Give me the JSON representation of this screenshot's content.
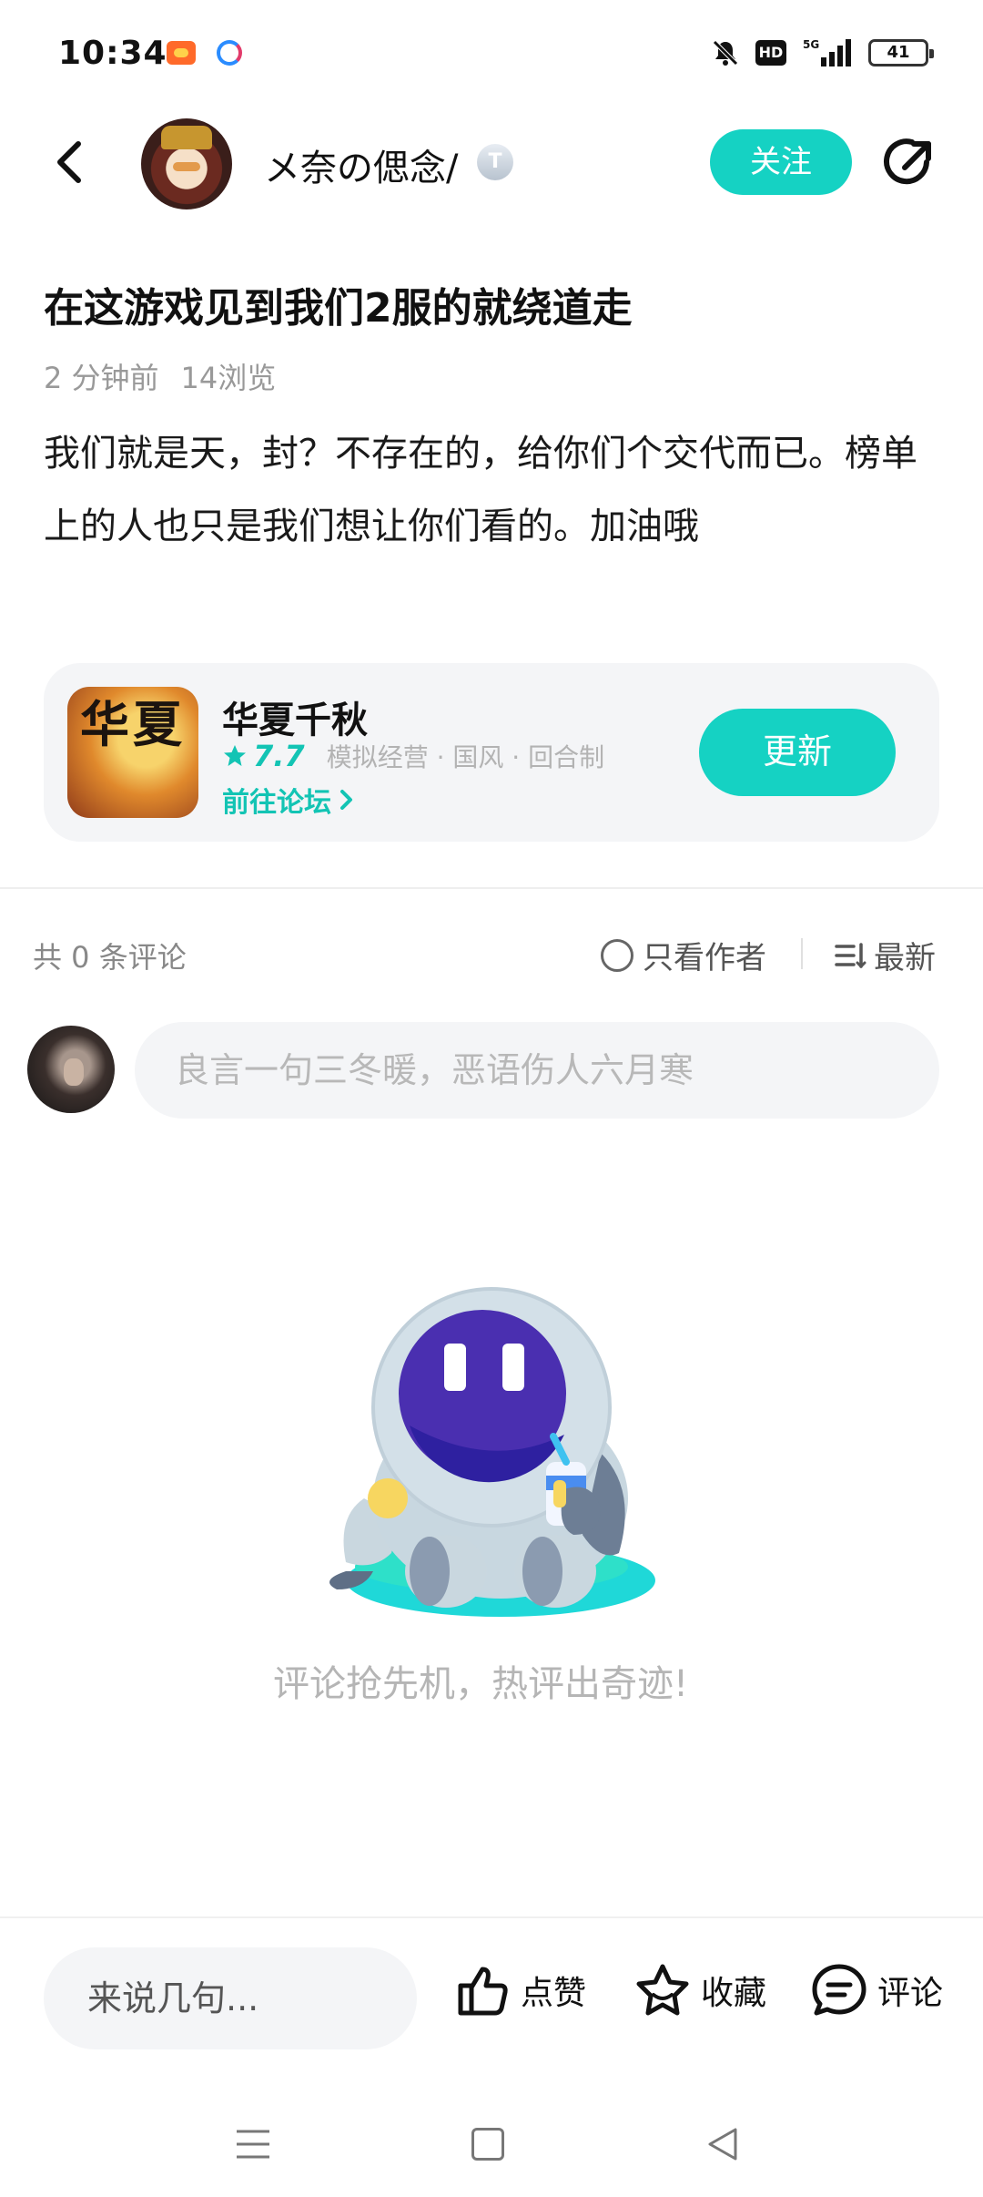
{
  "status_bar": {
    "time": "10:34",
    "hd": "HD",
    "network": "5G",
    "battery": "41"
  },
  "header": {
    "author_name": "メ奈の偲念/",
    "badge": "T",
    "follow_label": "关注"
  },
  "post": {
    "title": "在这游戏见到我们2服的就绕道走",
    "time_ago": "2 分钟前",
    "views": "14浏览",
    "body": "我们就是天，封？不存在的，给你们个交代而已。榜单上的人也只是我们想让你们看的。加油哦"
  },
  "game_card": {
    "icon_text": "华夏",
    "name": "华夏千秋",
    "rating": "7.7",
    "tags": "模拟经营 · 国风 · 回合制",
    "forum_link": "前往论坛",
    "update_label": "更新"
  },
  "comments": {
    "count_label": "共 0 条评论",
    "only_author_label": "只看作者",
    "sort_label": "最新",
    "input_placeholder": "良言一句三冬暖，恶语伤人六月寒",
    "empty_text": "评论抢先机，热评出奇迹!"
  },
  "bottom_bar": {
    "say_placeholder": "来说几句...",
    "like_label": "点赞",
    "favorite_label": "收藏",
    "comment_label": "评论"
  },
  "colors": {
    "accent": "#15d2c3",
    "accent_text": "#13c4b4",
    "robot_purple": "#4a2fb0",
    "robot_cyan": "#1fd8d8"
  }
}
